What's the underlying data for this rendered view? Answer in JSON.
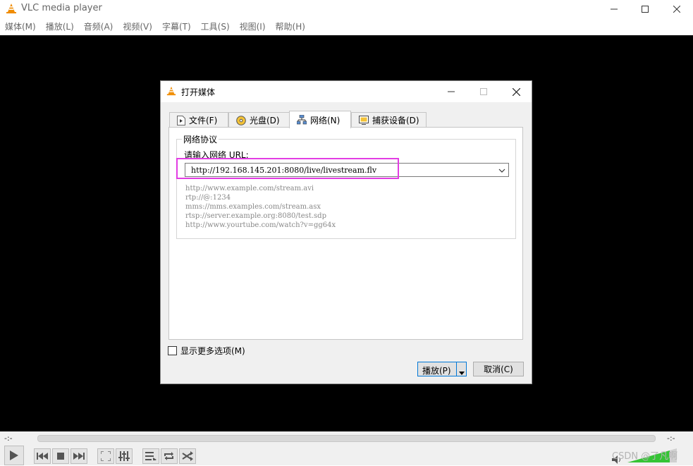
{
  "window": {
    "title": "VLC media player"
  },
  "menu": [
    "媒体(M)",
    "播放(L)",
    "音频(A)",
    "视频(V)",
    "字幕(T)",
    "工具(S)",
    "视图(I)",
    "帮助(H)"
  ],
  "player": {
    "time_elapsed": "-:-",
    "time_remaining": "-:-",
    "watermark": "CSDN @了凡啊"
  },
  "dialog": {
    "title": "打开媒体",
    "tabs": [
      {
        "label": "文件(F)",
        "icon": "file-icon"
      },
      {
        "label": "光盘(D)",
        "icon": "disc-icon"
      },
      {
        "label": "网络(N)",
        "icon": "network-icon"
      },
      {
        "label": "捕获设备(D)",
        "icon": "capture-device-icon"
      }
    ],
    "active_tab": "网络(N)",
    "group_title": "网络协议",
    "url_label": "请输入网络 URL:",
    "url_value": "http://192.168.145.201:8080/live/livestream.flv",
    "examples": [
      "http://www.example.com/stream.avi",
      "rtp://@:1234",
      "mms://mms.examples.com/stream.asx",
      "rtsp://server.example.org:8080/test.sdp",
      "http://www.yourtube.com/watch?v=gg64x"
    ],
    "show_more_options": "显示更多选项(M)",
    "play_label": "播放(P)",
    "cancel_label": "取消(C)"
  },
  "colors": {
    "highlight": "#e23de3",
    "focus_border": "#0078d7",
    "vlc_orange": "#f08c00"
  }
}
